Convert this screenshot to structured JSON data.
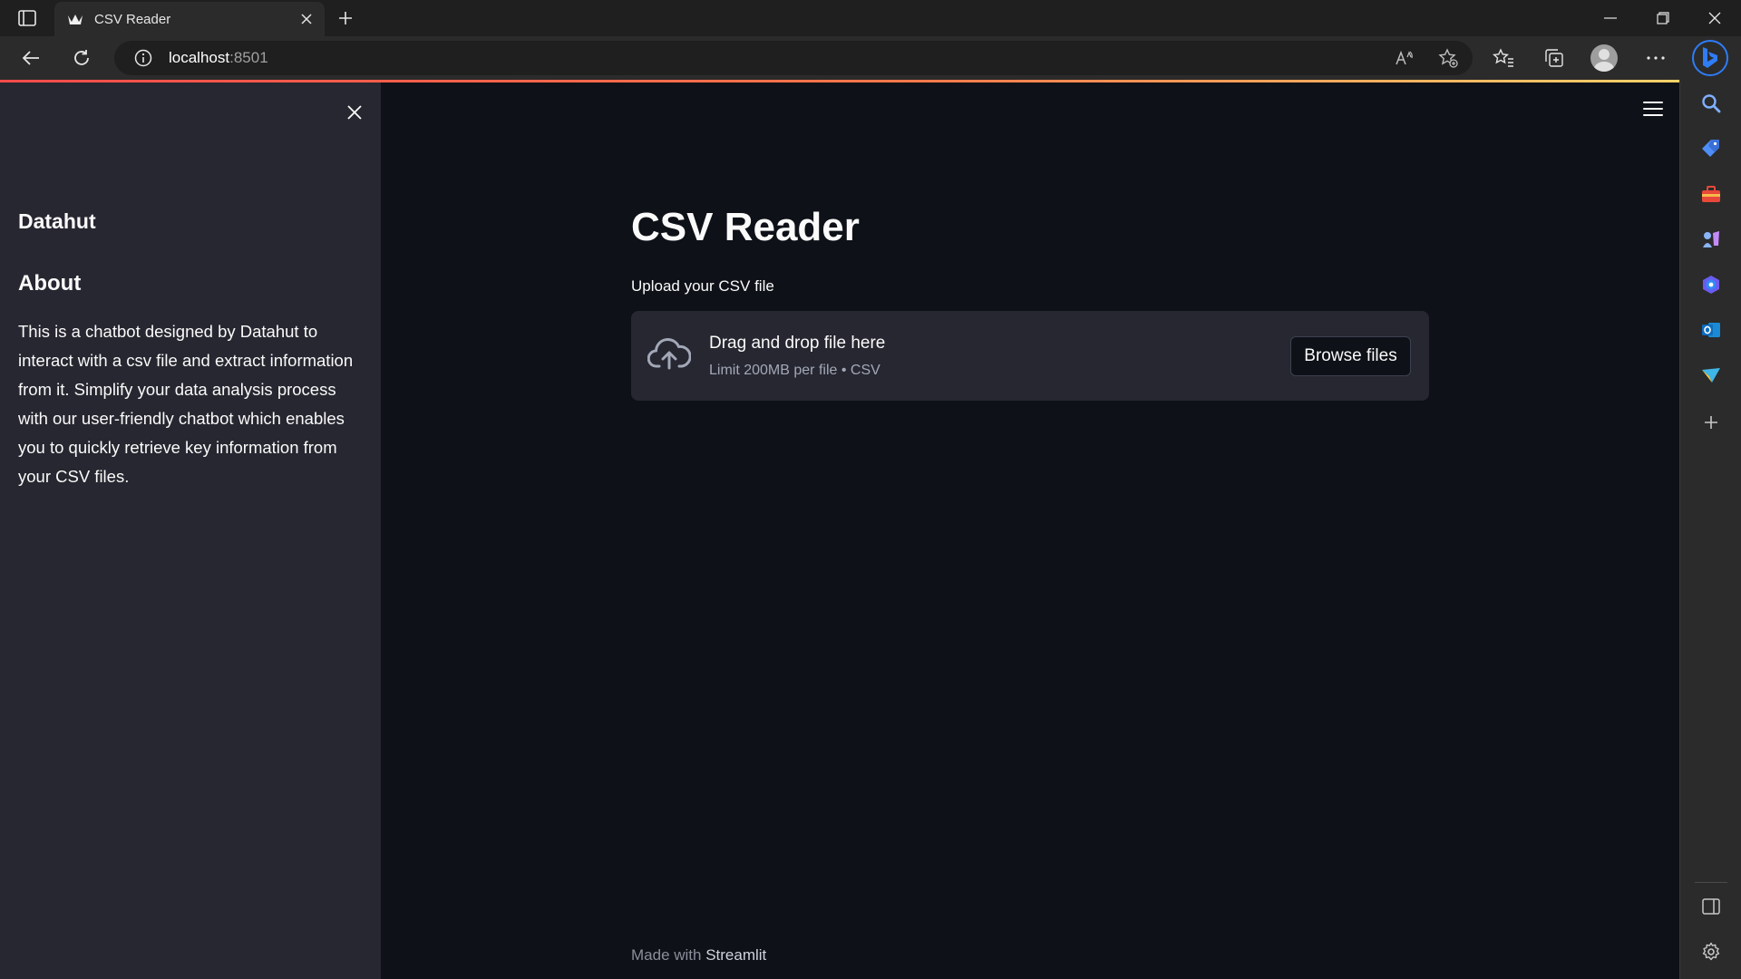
{
  "browser": {
    "tab_title": "CSV Reader",
    "url_host": "localhost",
    "url_port": ":8501"
  },
  "sidebar": {
    "brand": "Datahut",
    "about_heading": "About",
    "about_text": "This is a chatbot designed by Datahut to interact with a csv file and extract information from it. Simplify your data analysis process with our user-friendly chatbot which enables you to quickly retrieve key information from your CSV files."
  },
  "main": {
    "title": "CSV Reader",
    "uploader": {
      "label": "Upload your CSV file",
      "drag_text": "Drag and drop file here",
      "limit_text": "Limit 200MB per file • CSV",
      "browse_label": "Browse files"
    },
    "footer": {
      "prefix": "Made with ",
      "brand": "Streamlit"
    }
  },
  "colors": {
    "app_bg": "#0e1117",
    "sidebar_bg": "#262730",
    "accent": "#ff4b4b",
    "text": "#fafafa",
    "muted_text": "#a3a8b8"
  },
  "icons": {
    "tab_actions": "tab-actions-icon",
    "favicon": "streamlit-crown-icon",
    "back": "back-arrow-icon",
    "refresh": "refresh-icon",
    "info": "info-icon",
    "read_aloud": "read-aloud-icon",
    "add_favorite": "add-favorite-icon",
    "favorites": "favorites-icon",
    "collections": "collections-icon",
    "more": "more-icon",
    "bing": "bing-icon",
    "upload": "cloud-upload-icon",
    "menu": "hamburger-menu-icon"
  }
}
